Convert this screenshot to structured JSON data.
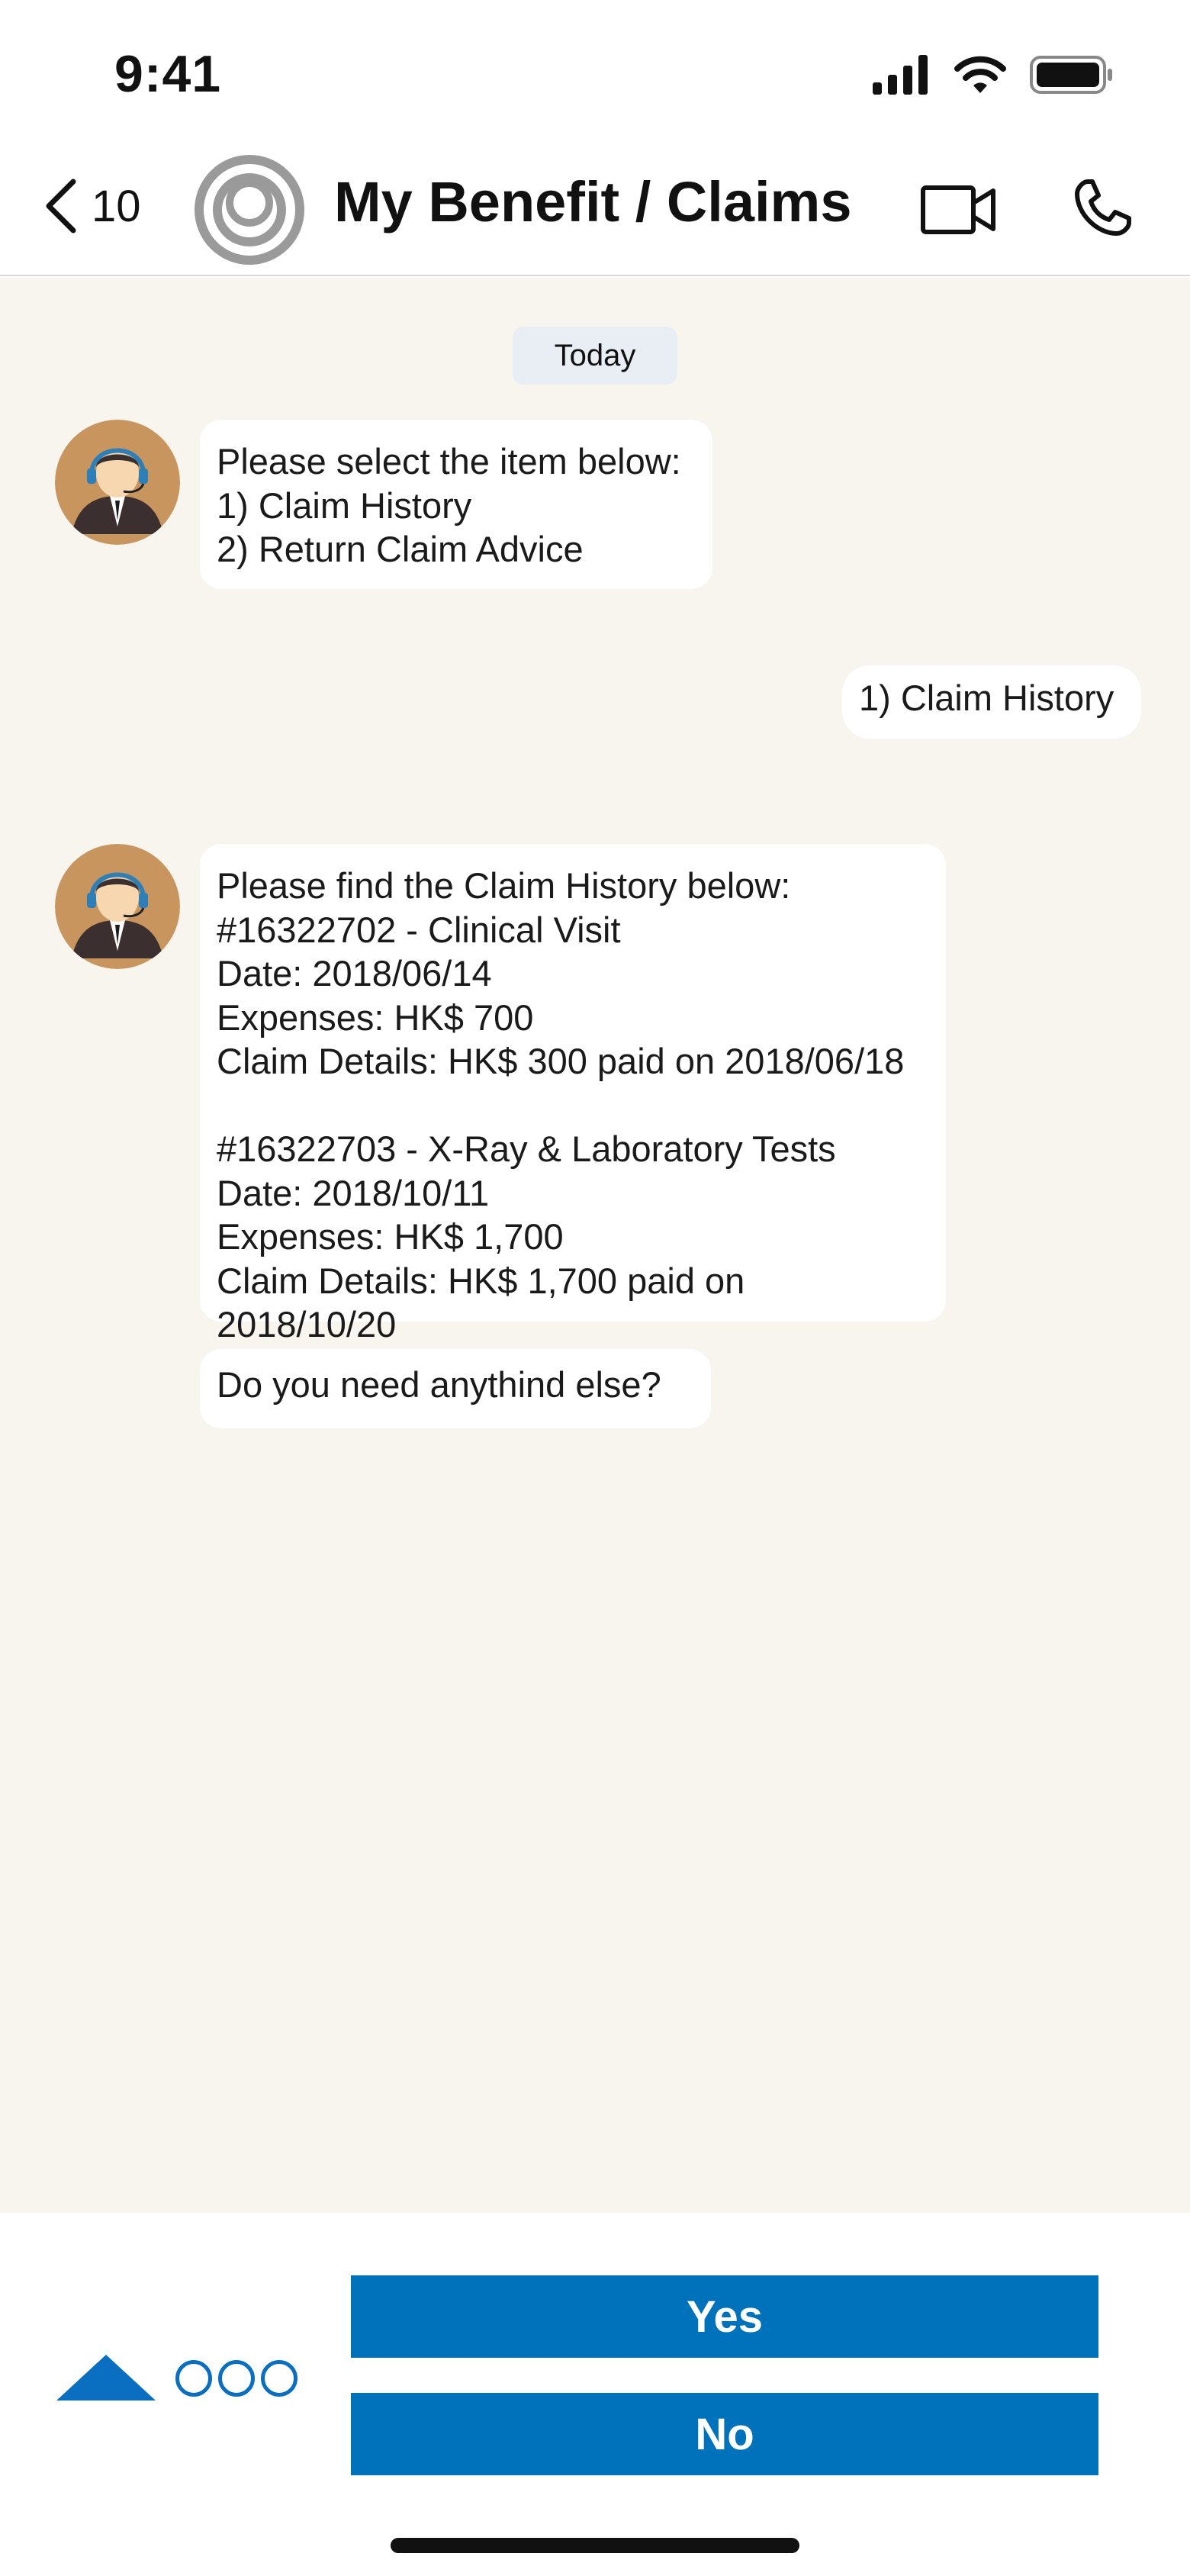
{
  "status_bar": {
    "time": "9:41",
    "icons": [
      "signal-icon",
      "wifi-icon",
      "battery-icon"
    ]
  },
  "header": {
    "back_count": "10",
    "title": "My Benefit / Claims",
    "icons": [
      "back-chevron-icon",
      "contact-avatar-icon",
      "video-call-icon",
      "phone-call-icon"
    ]
  },
  "chat": {
    "date_label": "Today",
    "messages": [
      {
        "sender": "agent",
        "text": "Please select the item below:\n1) Claim History\n2) Return Claim Advice"
      },
      {
        "sender": "user",
        "text": "1) Claim History"
      },
      {
        "sender": "agent",
        "text": "Please find the Claim History below:\n#16322702 - Clinical Visit\nDate: 2018/06/14\nExpenses: HK$ 700\nClaim Details: HK$ 300 paid on 2018/06/18\n\n#16322703 - X-Ray & Laboratory Tests\nDate: 2018/10/11\nExpenses: HK$ 1,700\nClaim Details: HK$ 1,700 paid on 2018/10/20"
      },
      {
        "sender": "agent",
        "text": "Do you need anythind else?"
      }
    ]
  },
  "quick_replies": {
    "yes_label": "Yes",
    "no_label": "No"
  },
  "colors": {
    "accent": "#0072bc",
    "chat_background": "#f8f5ef",
    "bubble": "#ffffff",
    "date_chip": "#e9eef5"
  }
}
